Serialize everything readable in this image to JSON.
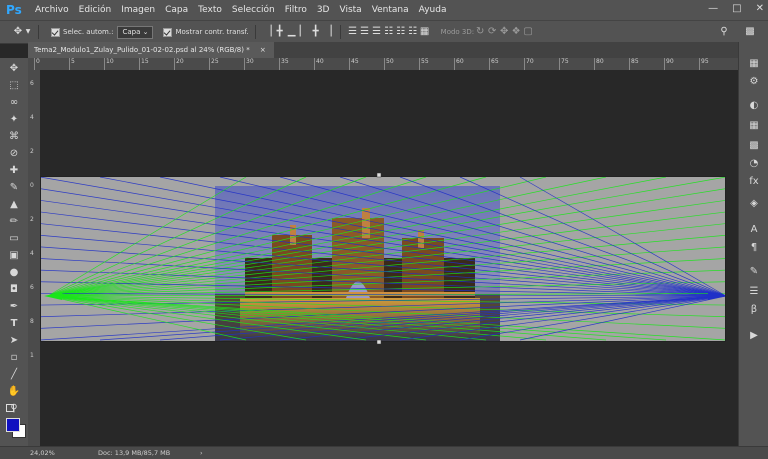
{
  "app": {
    "logo": "Ps"
  },
  "menu": [
    "Archivo",
    "Edición",
    "Imagen",
    "Capa",
    "Texto",
    "Selección",
    "Filtro",
    "3D",
    "Vista",
    "Ventana",
    "Ayuda"
  ],
  "options_bar": {
    "auto_select_label": "Selec. autom.:",
    "auto_select_value": "Capa",
    "show_transform_label": "Mostrar contr. transf.",
    "mode_3d_label": "Modo 3D:"
  },
  "document": {
    "tab_title": "Tema2_Modulo1_Zulay_Pulido_01-02-02.psd al 24% (RGB/8) *",
    "ruler_h_labels": [
      "0",
      "5",
      "10",
      "15",
      "20",
      "25",
      "30",
      "35",
      "40",
      "45",
      "50",
      "55",
      "60",
      "65",
      "70",
      "75",
      "80",
      "85",
      "90",
      "95"
    ],
    "ruler_v_labels": [
      "6",
      "4",
      "2",
      "0",
      "2",
      "4",
      "6",
      "8",
      "1"
    ]
  },
  "status": {
    "zoom": "24,02%",
    "doc_info": "Doc: 13,9 MB/85,7 MB"
  },
  "colors": {
    "foreground": "#1010c0",
    "background": "#ffffff",
    "guide_green": "#19e619",
    "guide_blue": "#2030c8"
  }
}
